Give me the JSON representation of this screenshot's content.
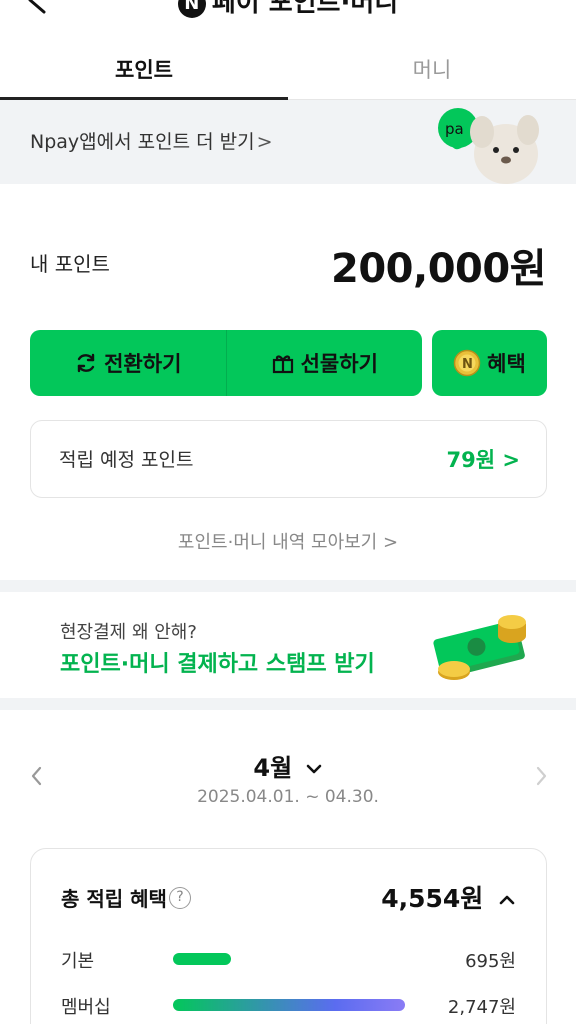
{
  "header": {
    "title": "페이 포인트·머니",
    "logo_letter": "N"
  },
  "tabs": [
    {
      "label": "포인트"
    },
    {
      "label": "머니"
    }
  ],
  "banner": {
    "text": "Npay앱에서 포인트 더 받기",
    "chevron": ">",
    "badge_text": "pa"
  },
  "my_points": {
    "label": "내 포인트",
    "value": "200,000원"
  },
  "actions": {
    "convert_label": "전환하기",
    "gift_label": "선물하기",
    "benefit_label": "혜택"
  },
  "expected": {
    "label": "적립 예정 포인트",
    "value": "79원 >"
  },
  "history_link": "포인트·머니 내역 모아보기 >",
  "stamp_promo": {
    "sub": "현장결제 왜 안해?",
    "main": "포인트·머니 결제하고 스탬프 받기"
  },
  "month": {
    "title": "4월",
    "range": "2025.04.01. ~ 04.30."
  },
  "total": {
    "label": "총 적립 혜택",
    "help": "?",
    "value": "4,554원",
    "rows": [
      {
        "label": "기본",
        "value": "695원",
        "share": 0.2
      },
      {
        "label": "멤버십",
        "value": "2,747원",
        "share": 0.8
      }
    ]
  },
  "colors": {
    "accent": "#03c75a",
    "accent_text": "#03b34f",
    "gray_bg": "#f1f3f5"
  }
}
